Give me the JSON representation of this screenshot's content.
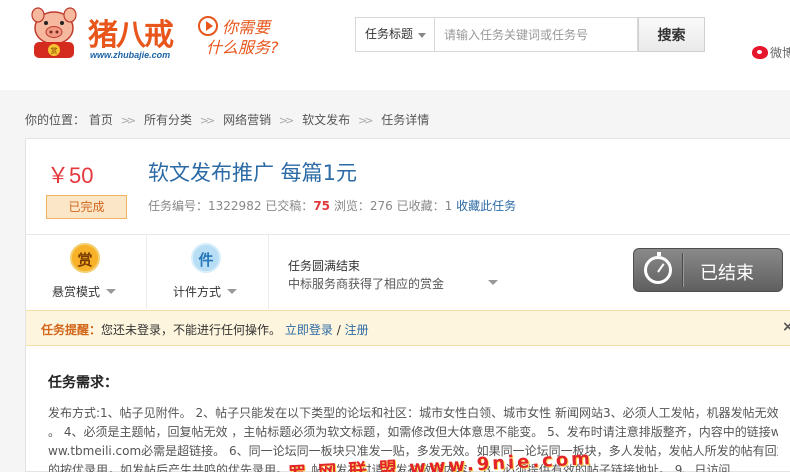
{
  "header": {
    "logo_text": "猪八戒",
    "logo_url": "www.zhubajie.com",
    "slogan_line1": "你需要",
    "slogan_line2": "什么服务?",
    "search": {
      "type_selected": "任务标题",
      "placeholder": "请输入任务关键词或任务号",
      "button_label": "搜索"
    },
    "weibo_label": "微博"
  },
  "breadcrumb": {
    "prefix": "你的位置：",
    "items": [
      "首页",
      "所有分类",
      "网络营销",
      "软文发布",
      "任务详情"
    ]
  },
  "task": {
    "price": "￥50",
    "status": "已完成",
    "title": "软文发布推广 每篇1元",
    "id_label": "任务编号：",
    "id_value": "1322982",
    "submitted_label": "已交稿：",
    "submitted_value": "75",
    "views_label": "浏览：",
    "views_value": "276",
    "favorites_label": "已收藏：",
    "favorites_value": "1",
    "favorite_link": "收藏此任务"
  },
  "modes": {
    "reward_icon": "赏",
    "reward_label": "悬赏模式",
    "piece_icon": "件",
    "piece_label": "计件方式",
    "end_title": "任务圆满结束",
    "end_desc": "中标服务商获得了相应的赏金",
    "ended_button": "已结束"
  },
  "notice": {
    "tag": "任务提醒：",
    "text": "您还未登录，不能进行任何操作。",
    "login_link": "立即登录",
    "separator": "/",
    "register_link": "注册",
    "close": "×"
  },
  "requirements": {
    "title": "任务需求：",
    "lines": [
      "发布方式:1、帖子见附件。 2、帖子只能发在以下类型的论坛和社区：城市女性白领、城市女性 新闻网站3、必须人工发帖，机器发帖无效",
      "。 4、必须是主题帖，回复帖无效 ，主帖标题必须为软文标题，如需修改但大体意思不能变。 5、发布时请注意排版整齐，内容中的链接w",
      "ww.tbmeili.com必需是超链接。 6、同一论坛同一板块只准发一贴，多发无效。如果同一论坛同一板块，多人发帖，发帖人所发的帖有回复",
      "的按优录用，如发帖后产生共鸣的优先录用。 7、帖子发布时请勿发布敏感内容。 8、必须提供有效的帖子链接地址。 9、日访问"
    ]
  },
  "watermark": "罗 网 联 盟 www.9nie.com"
}
